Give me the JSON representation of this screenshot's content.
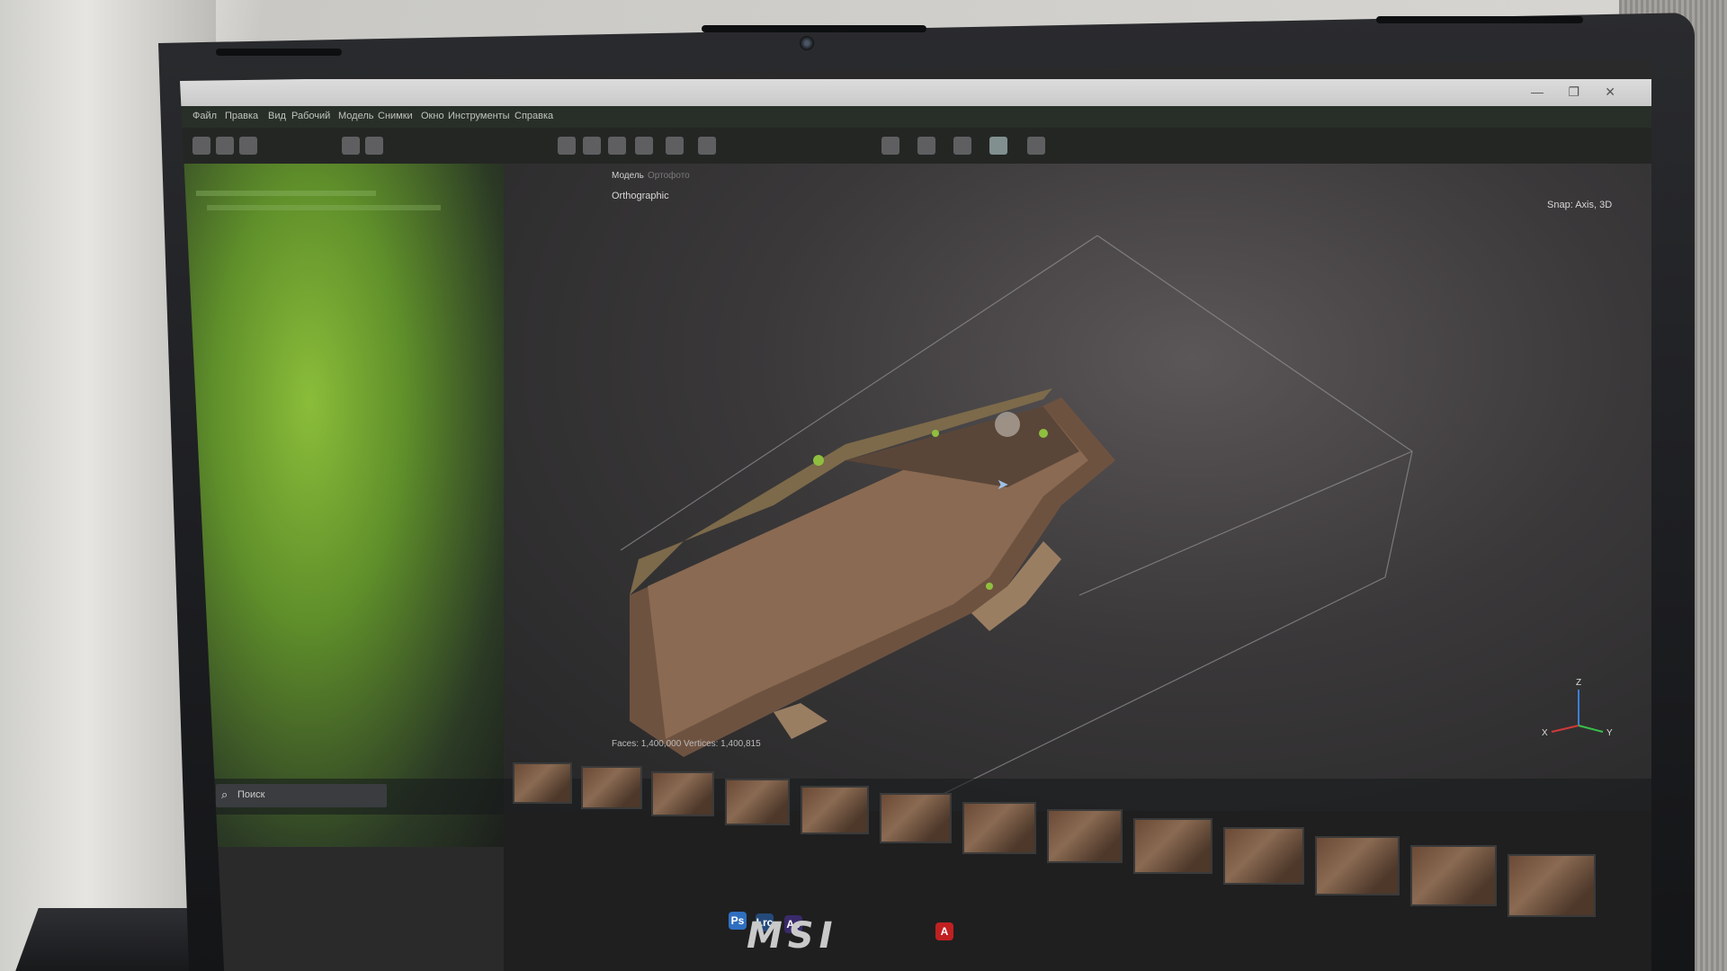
{
  "app": {
    "title": "",
    "menu": [
      "Файл",
      "Правка",
      "Вид",
      "Рабочий",
      "Модель",
      "Снимки",
      "Окно",
      "Инструменты",
      "Справка"
    ]
  },
  "viewport": {
    "tabs": [
      "Модель",
      "Ортофото"
    ],
    "projection": "Orthographic",
    "snap_label": "Snap: Axis, 3D",
    "status_text": "Faces: 1,400,000 Vertices: 1,400,815"
  },
  "taskbar": {
    "search_placeholder": "Поиск",
    "app_labels": [
      "Ps",
      "Lrc",
      "Ae",
      "A"
    ]
  },
  "axes": {
    "x": "X",
    "y": "Y",
    "z": "Z"
  },
  "device": {
    "brand": "MSI"
  },
  "colors": {
    "model_brown": "#7a5a44",
    "moss_green": "#8fbf3f",
    "accent_blue": "#2f7fd0"
  }
}
